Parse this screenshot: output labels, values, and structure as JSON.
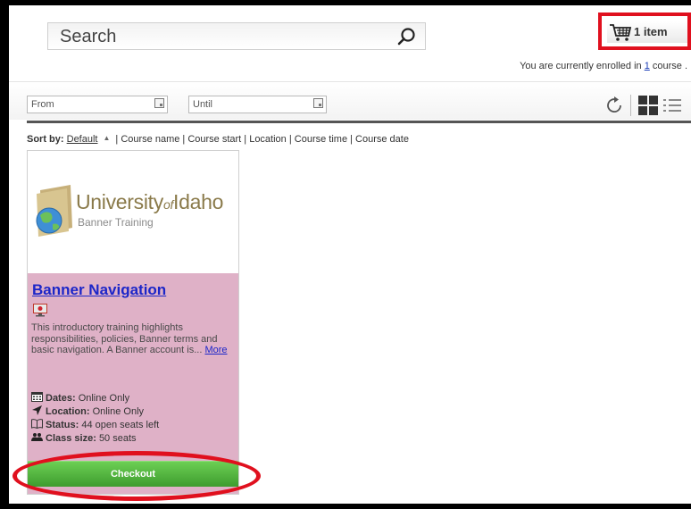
{
  "search": {
    "placeholder": "Search",
    "icon": "magnifier-icon"
  },
  "cart": {
    "label": "1 item",
    "icon": "shopping-cart-icon"
  },
  "enrollment": {
    "prefix": "You are currently enrolled in ",
    "count": "1",
    "suffix": " course ."
  },
  "filters": {
    "from": "From",
    "until": "Until"
  },
  "sort": {
    "label": "Sort by:",
    "default": "Default",
    "options": "| Course name | Course start | Location | Course time | Course date"
  },
  "course": {
    "logo_text_main": "University",
    "logo_text_of": "of",
    "logo_text_place": "Idaho",
    "logo_subtitle": "Banner Training",
    "title": "Banner Navigation",
    "description": "This introductory training highlights responsibilities, policies, Banner terms and basic navigation. A Banner account is...",
    "more": "More",
    "dates_label": "Dates:",
    "dates_value": "Online Only",
    "location_label": "Location:",
    "location_value": "Online Only",
    "status_label": "Status:",
    "status_value": "44 open seats left",
    "class_size_label": "Class size:",
    "class_size_value": "50 seats",
    "checkout": "Checkout"
  },
  "colors": {
    "annotation": "#e0101e",
    "card_body": "#dfb1c7",
    "link": "#1c26c8",
    "checkout_green": "#4caf38"
  }
}
